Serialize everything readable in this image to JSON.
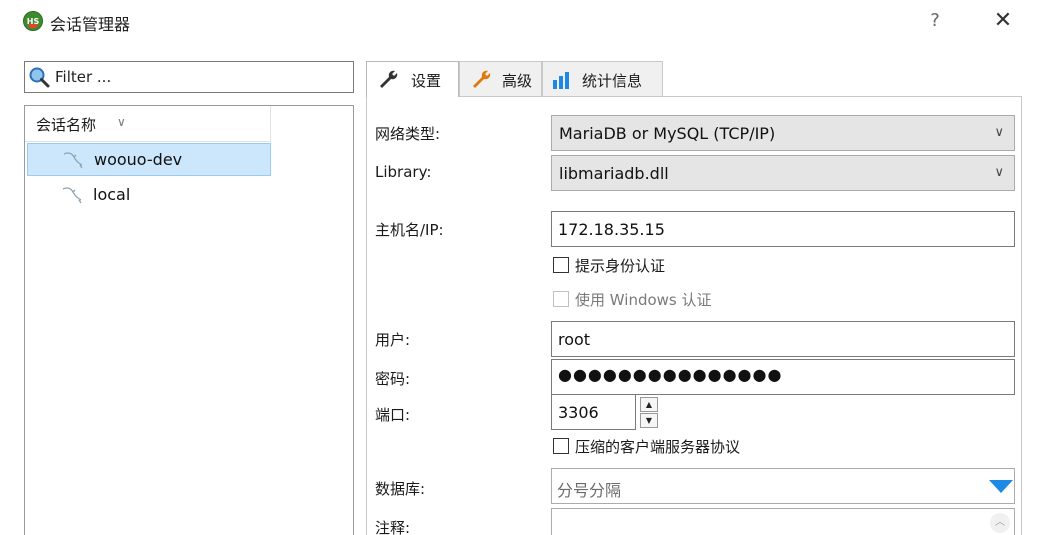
{
  "window": {
    "title": "会话管理器",
    "app_icon_text": "HS",
    "help": "?",
    "close": "✕"
  },
  "sidebar": {
    "filter_placeholder": "Filter ...",
    "column_header": "会话名称",
    "sessions": [
      {
        "label": "woouo-dev",
        "selected": true
      },
      {
        "label": "local",
        "selected": false
      }
    ]
  },
  "tabs": [
    {
      "label": "设置",
      "icon": "wrench-icon",
      "active": true
    },
    {
      "label": "高级",
      "icon": "wrench-icon",
      "active": false
    },
    {
      "label": "统计信息",
      "icon": "bar-chart-icon",
      "active": false
    }
  ],
  "settings": {
    "network_type": {
      "label": "网络类型:",
      "value": "MariaDB or MySQL (TCP/IP)"
    },
    "library": {
      "label": "Library:",
      "value": "libmariadb.dll"
    },
    "host": {
      "label": "主机名/IP:",
      "value": "172.18.35.15"
    },
    "prompt_auth": {
      "label": "提示身份认证",
      "checked": false
    },
    "windows_auth": {
      "label": "使用 Windows 认证",
      "checked": false,
      "disabled": true
    },
    "user": {
      "label": "用户:",
      "value": "root"
    },
    "password": {
      "label": "密码:",
      "value": "●●●●●●●●●●●●●●●"
    },
    "port": {
      "label": "端口:",
      "value": "3306"
    },
    "compress": {
      "label": "压缩的客户端服务器协议",
      "checked": false
    },
    "database": {
      "label": "数据库:",
      "placeholder": "分号分隔"
    },
    "comment": {
      "label": "注释:"
    }
  },
  "colors": {
    "selection_bg": "#cce6fb",
    "accent_blue": "#1e88e5",
    "wrench_orange": "#e07a10"
  }
}
